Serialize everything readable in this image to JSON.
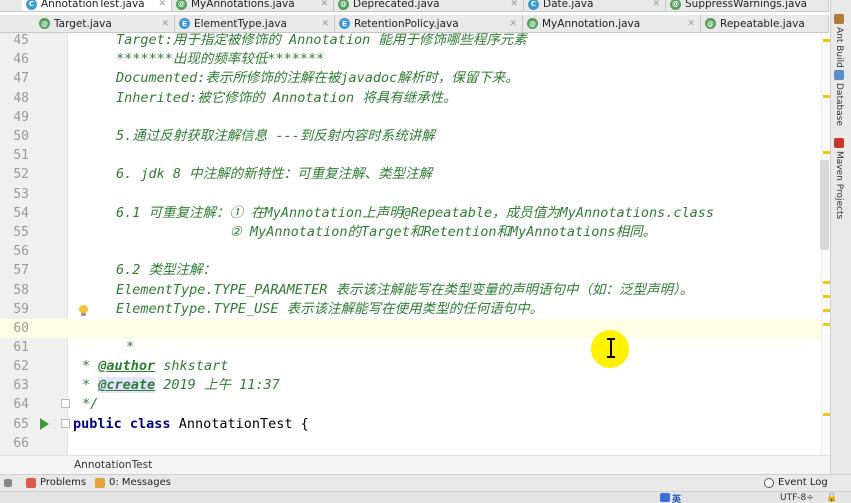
{
  "tabs_row1": [
    {
      "label": "AnnotationTest.java",
      "icon": "c",
      "active": true
    },
    {
      "label": "MyAnnotations.java",
      "icon": "a"
    },
    {
      "label": "Deprecated.java",
      "icon": "a"
    },
    {
      "label": "Date.java",
      "icon": "c"
    },
    {
      "label": "SuppressWarnings.java",
      "icon": "a"
    }
  ],
  "tabs_row2": [
    {
      "label": "Target.java",
      "icon": "a"
    },
    {
      "label": "ElementType.java",
      "icon": "e"
    },
    {
      "label": "RetentionPolicy.java",
      "icon": "e"
    },
    {
      "label": "MyAnnotation.java",
      "icon": "a"
    },
    {
      "label": "Repeatable.java",
      "icon": "a"
    }
  ],
  "code_lines": [
    {
      "num": "45",
      "text": "Target:用于指定被修饰的 Annotation 能用于修饰哪些程序元素"
    },
    {
      "num": "46",
      "text": "*******出现的频率较低*******"
    },
    {
      "num": "47",
      "text": "Documented:表示所修饰的注解在被javadoc解析时，保留下来。"
    },
    {
      "num": "48",
      "text": "Inherited:被它修饰的 Annotation 将具有继承性。"
    },
    {
      "num": "49",
      "text": ""
    },
    {
      "num": "50",
      "text": "5.通过反射获取注解信息 ---到反射内容时系统讲解"
    },
    {
      "num": "51",
      "text": ""
    },
    {
      "num": "52",
      "text": "6. jdk 8 中注解的新特性：可重复注解、类型注解"
    },
    {
      "num": "53",
      "text": ""
    },
    {
      "num": "54",
      "text": "6.1 可重复注解：① 在MyAnnotation上声明@Repeatable，成员值为MyAnnotations.class"
    },
    {
      "num": "55",
      "text": "              ② MyAnnotation的Target和Retention和MyAnnotations相同。"
    },
    {
      "num": "56",
      "text": ""
    },
    {
      "num": "57",
      "text": "6.2 类型注解："
    },
    {
      "num": "58",
      "text": "ElementType.TYPE_PARAMETER 表示该注解能写在类型变量的声明语句中（如：泛型声明）。"
    },
    {
      "num": "59",
      "text": "ElementType.TYPE_USE 表示该注解能写在使用类型的任何语句中。"
    },
    {
      "num": "60",
      "text": ""
    },
    {
      "num": "61",
      "text": "*"
    }
  ],
  "doc_lines": {
    "l62": {
      "num": "62",
      "prefix": "* ",
      "tag": "@author",
      "rest": " shkstart"
    },
    "l63": {
      "num": "63",
      "prefix": "* ",
      "tag": "@create",
      "rest": " 2019 上午 11:37"
    },
    "l64": {
      "num": "64",
      "text": "*/"
    },
    "l65": {
      "num": "65",
      "kw1": "public",
      "kw2": "class",
      "rest": " AnnotationTest {"
    },
    "l66": {
      "num": "66"
    }
  },
  "breadcrumb": "AnnotationTest",
  "bottom_tools": {
    "problems": "Problems",
    "messages": "0: Messages",
    "event_log": "Event Log"
  },
  "right_tools": [
    "Ant Build",
    "Database",
    "Maven Projects"
  ],
  "status": {
    "encoding": "UTF-8÷",
    "ime": "英"
  },
  "colors": {
    "comment": "#2e7d32",
    "keyword": "#000080",
    "current_line": "#fffde3",
    "mouse_highlight": "#fff200"
  }
}
